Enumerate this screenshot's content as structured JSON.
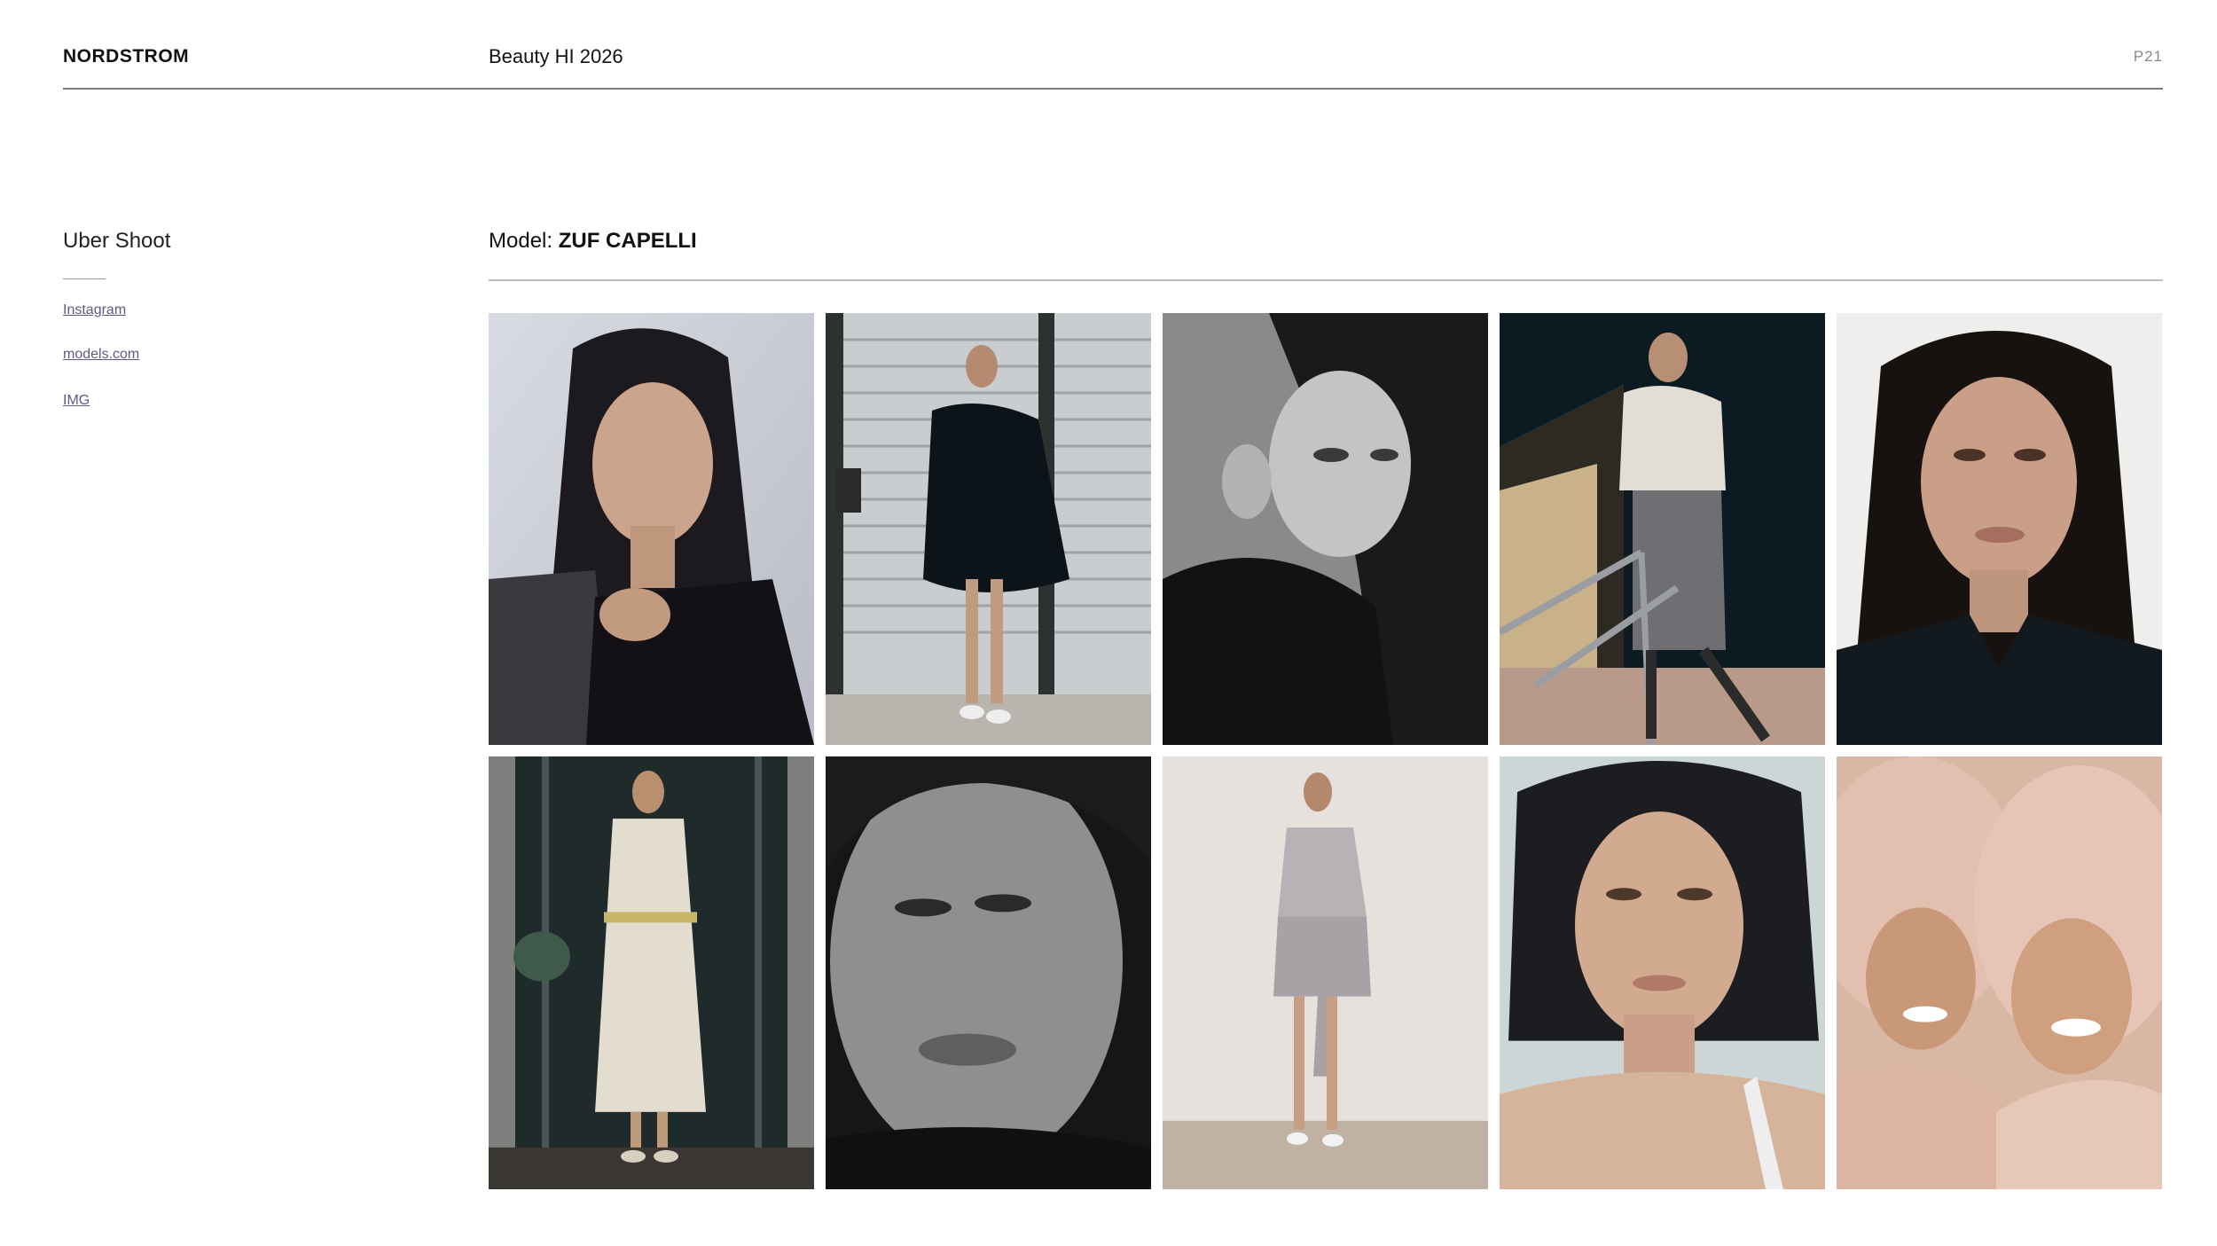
{
  "header": {
    "brand": "NORDSTROM",
    "title": "Beauty HI 2026",
    "page": "P21"
  },
  "sidebar": {
    "section_title": "Uber Shoot",
    "links": [
      {
        "label": "Instagram"
      },
      {
        "label": "models.com"
      },
      {
        "label": "IMG"
      }
    ]
  },
  "main": {
    "model_prefix": "Model:",
    "model_name": "ZUF CAPELLI"
  },
  "gallery": {
    "photos": [
      {
        "desc": "portrait-leather-top",
        "tone": "color"
      },
      {
        "desc": "full-body-black-ruffle-dress",
        "tone": "color"
      },
      {
        "desc": "bw-profile-portrait",
        "tone": "bw"
      },
      {
        "desc": "white-jacket-railing",
        "tone": "color"
      },
      {
        "desc": "portrait-black-shirt",
        "tone": "color"
      },
      {
        "desc": "full-body-embroidered-coat",
        "tone": "color"
      },
      {
        "desc": "bw-close-up-face",
        "tone": "bw"
      },
      {
        "desc": "full-body-grey-dress",
        "tone": "color"
      },
      {
        "desc": "close-up-wet-hair",
        "tone": "color"
      },
      {
        "desc": "two-models-fur-hats",
        "tone": "color"
      }
    ]
  }
}
